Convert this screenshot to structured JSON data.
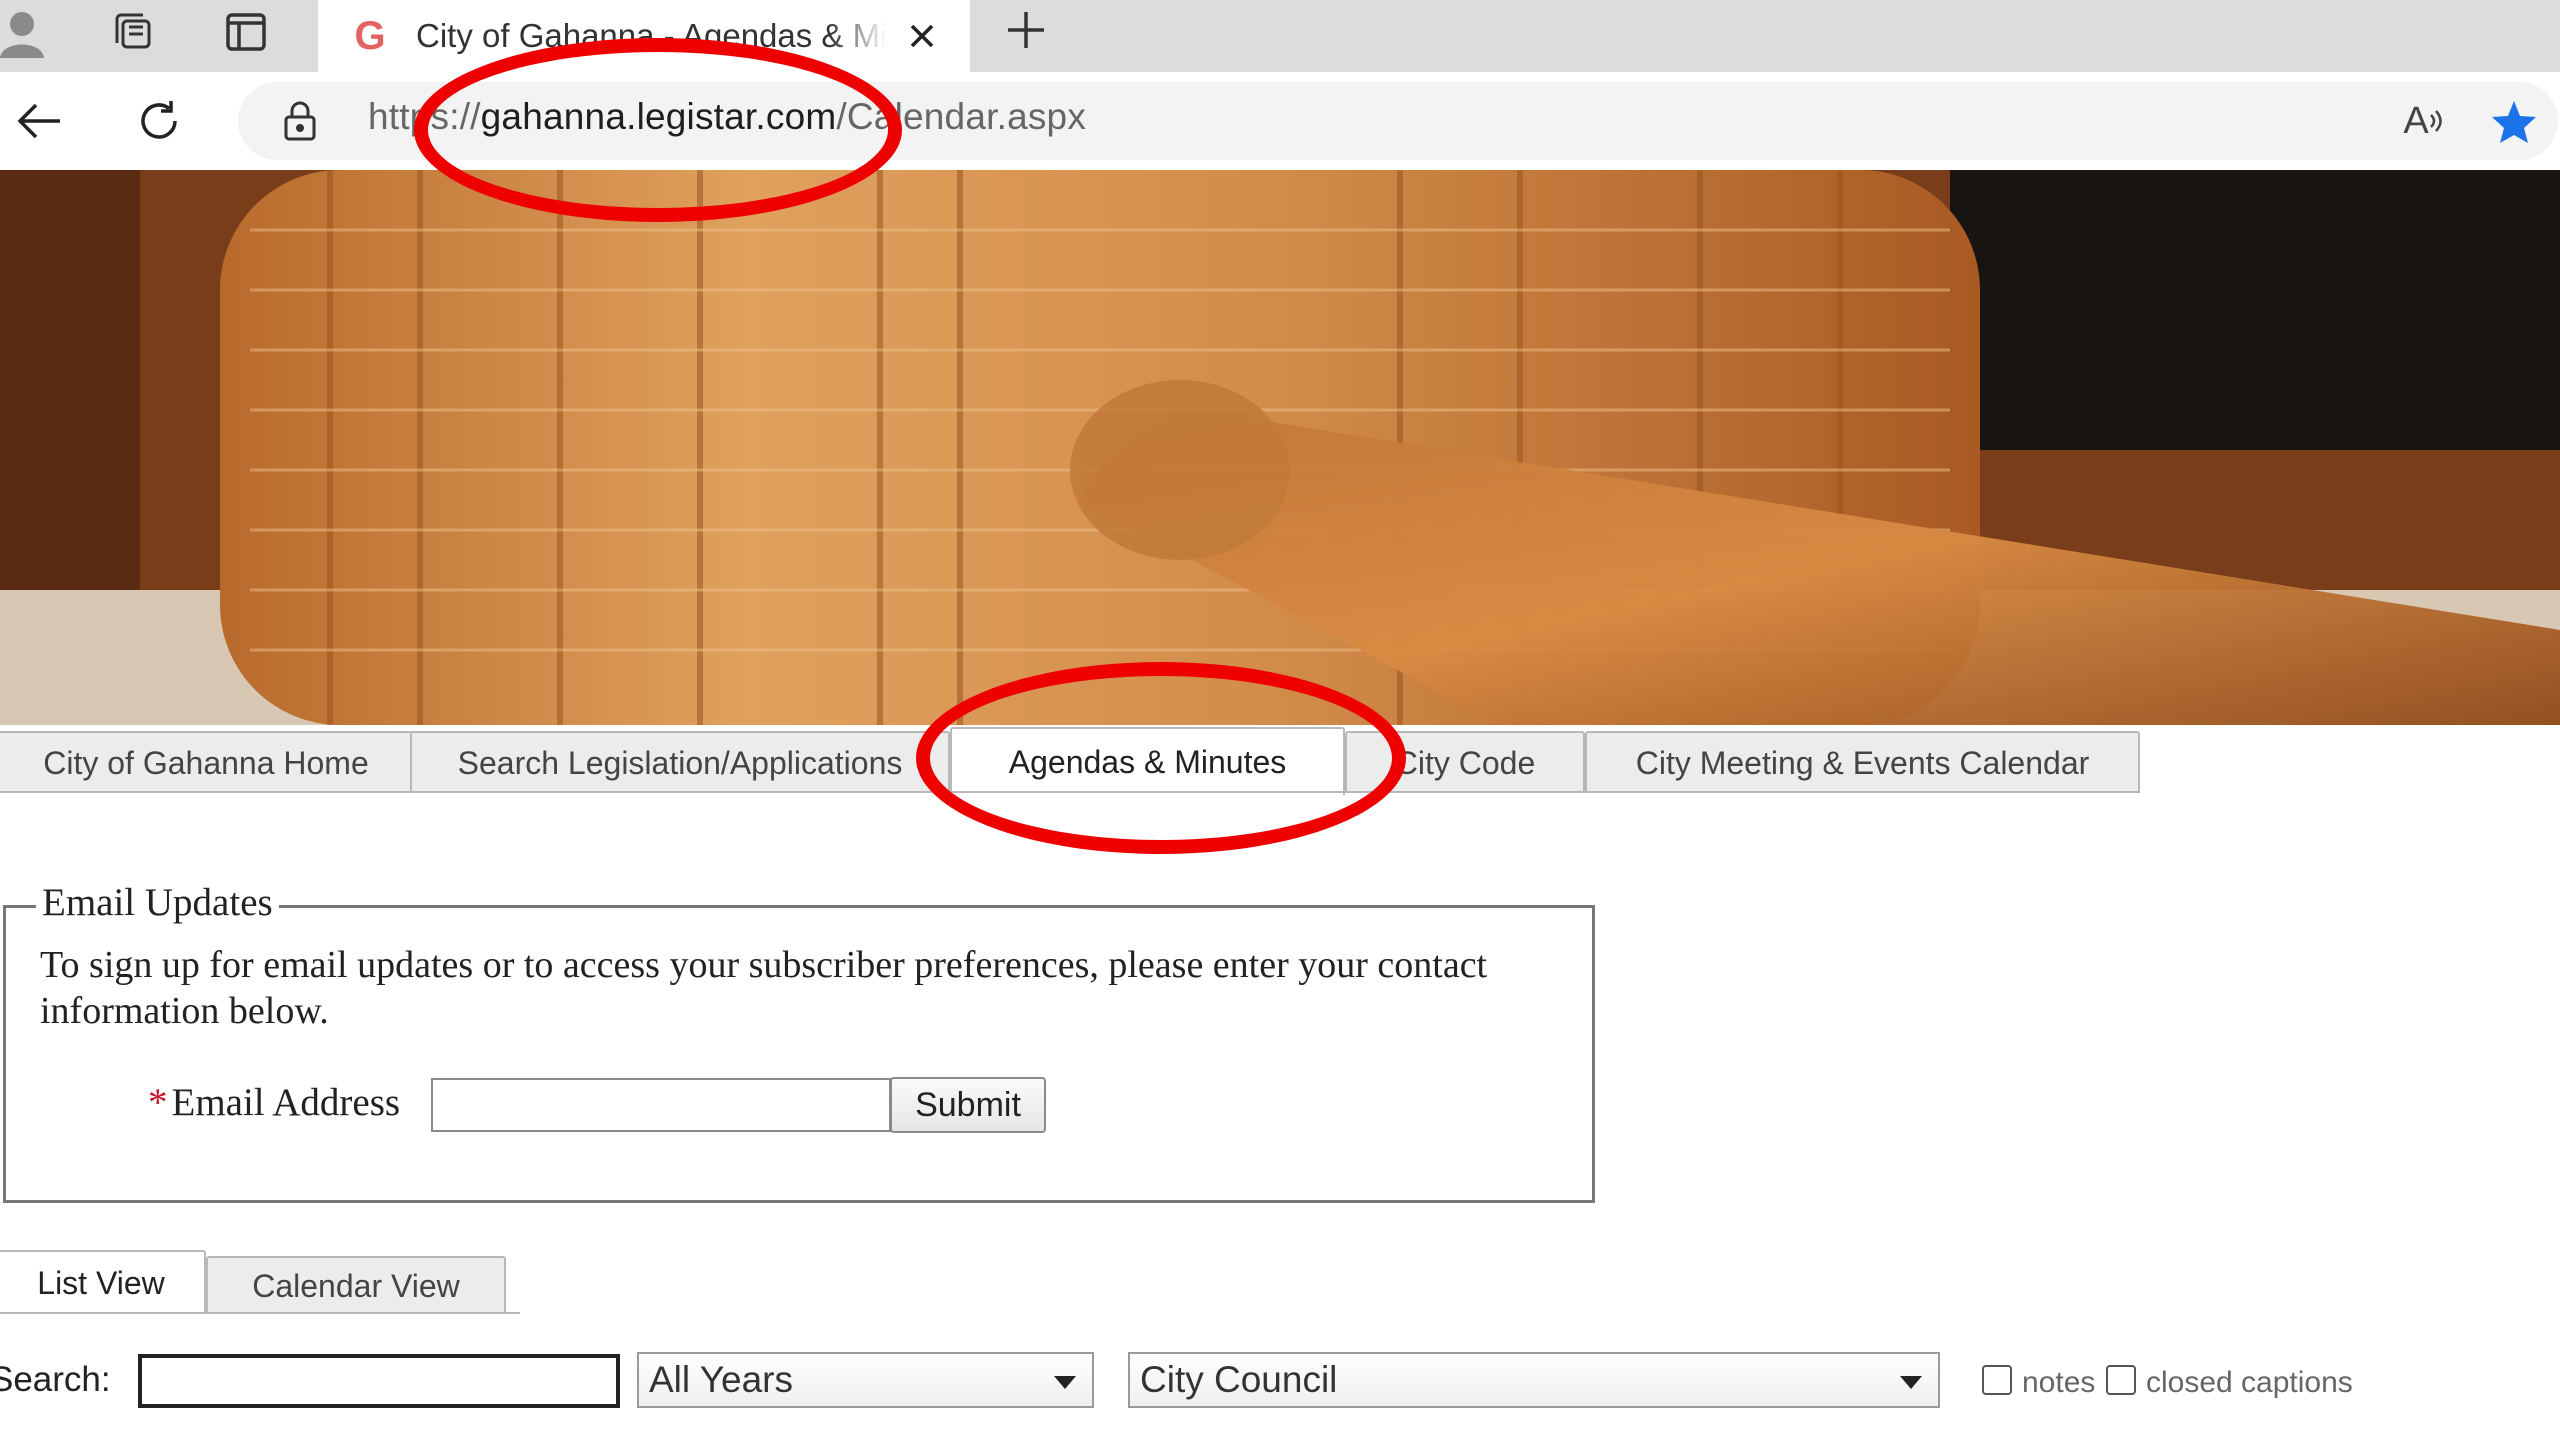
{
  "browser": {
    "tab_title": "City of Gahanna - Agendas & Minutes",
    "tab_favicon_letter": "G",
    "url_prefix": "https://",
    "url_host": "gahanna.legistar.com",
    "url_path": "/Calendar.aspx",
    "read_aloud_glyph": "A",
    "icons": [
      "profile-icon",
      "collections-icon",
      "vertical-tabs-icon",
      "close-icon",
      "plus-icon",
      "back-arrow-icon",
      "refresh-icon",
      "lock-icon",
      "read-aloud-icon",
      "favorite-star-icon"
    ]
  },
  "site_tabs": [
    {
      "label": "City of Gahanna Home"
    },
    {
      "label": "Search Legislation/Applications"
    },
    {
      "label": "Agendas & Minutes"
    },
    {
      "label": "City Code"
    },
    {
      "label": "City Meeting & Events Calendar"
    }
  ],
  "email_updates": {
    "legend": "Email Updates",
    "description": "To sign up for email updates or to access your subscriber preferences, please enter your contact information below.",
    "required_mark": "*",
    "email_label": "Email Address",
    "email_value": "",
    "submit_label": "Submit"
  },
  "view_tabs": [
    {
      "label": "List View"
    },
    {
      "label": "Calendar View"
    }
  ],
  "search": {
    "label": "Search:",
    "value": "",
    "year_select": "All Years",
    "body_select": "City Council",
    "notes_label": "notes",
    "closed_captions_label": "closed captions"
  },
  "colors": {
    "annotation": "#ee0000",
    "favorite_star": "#1a73e8",
    "required": "#c8102e"
  }
}
